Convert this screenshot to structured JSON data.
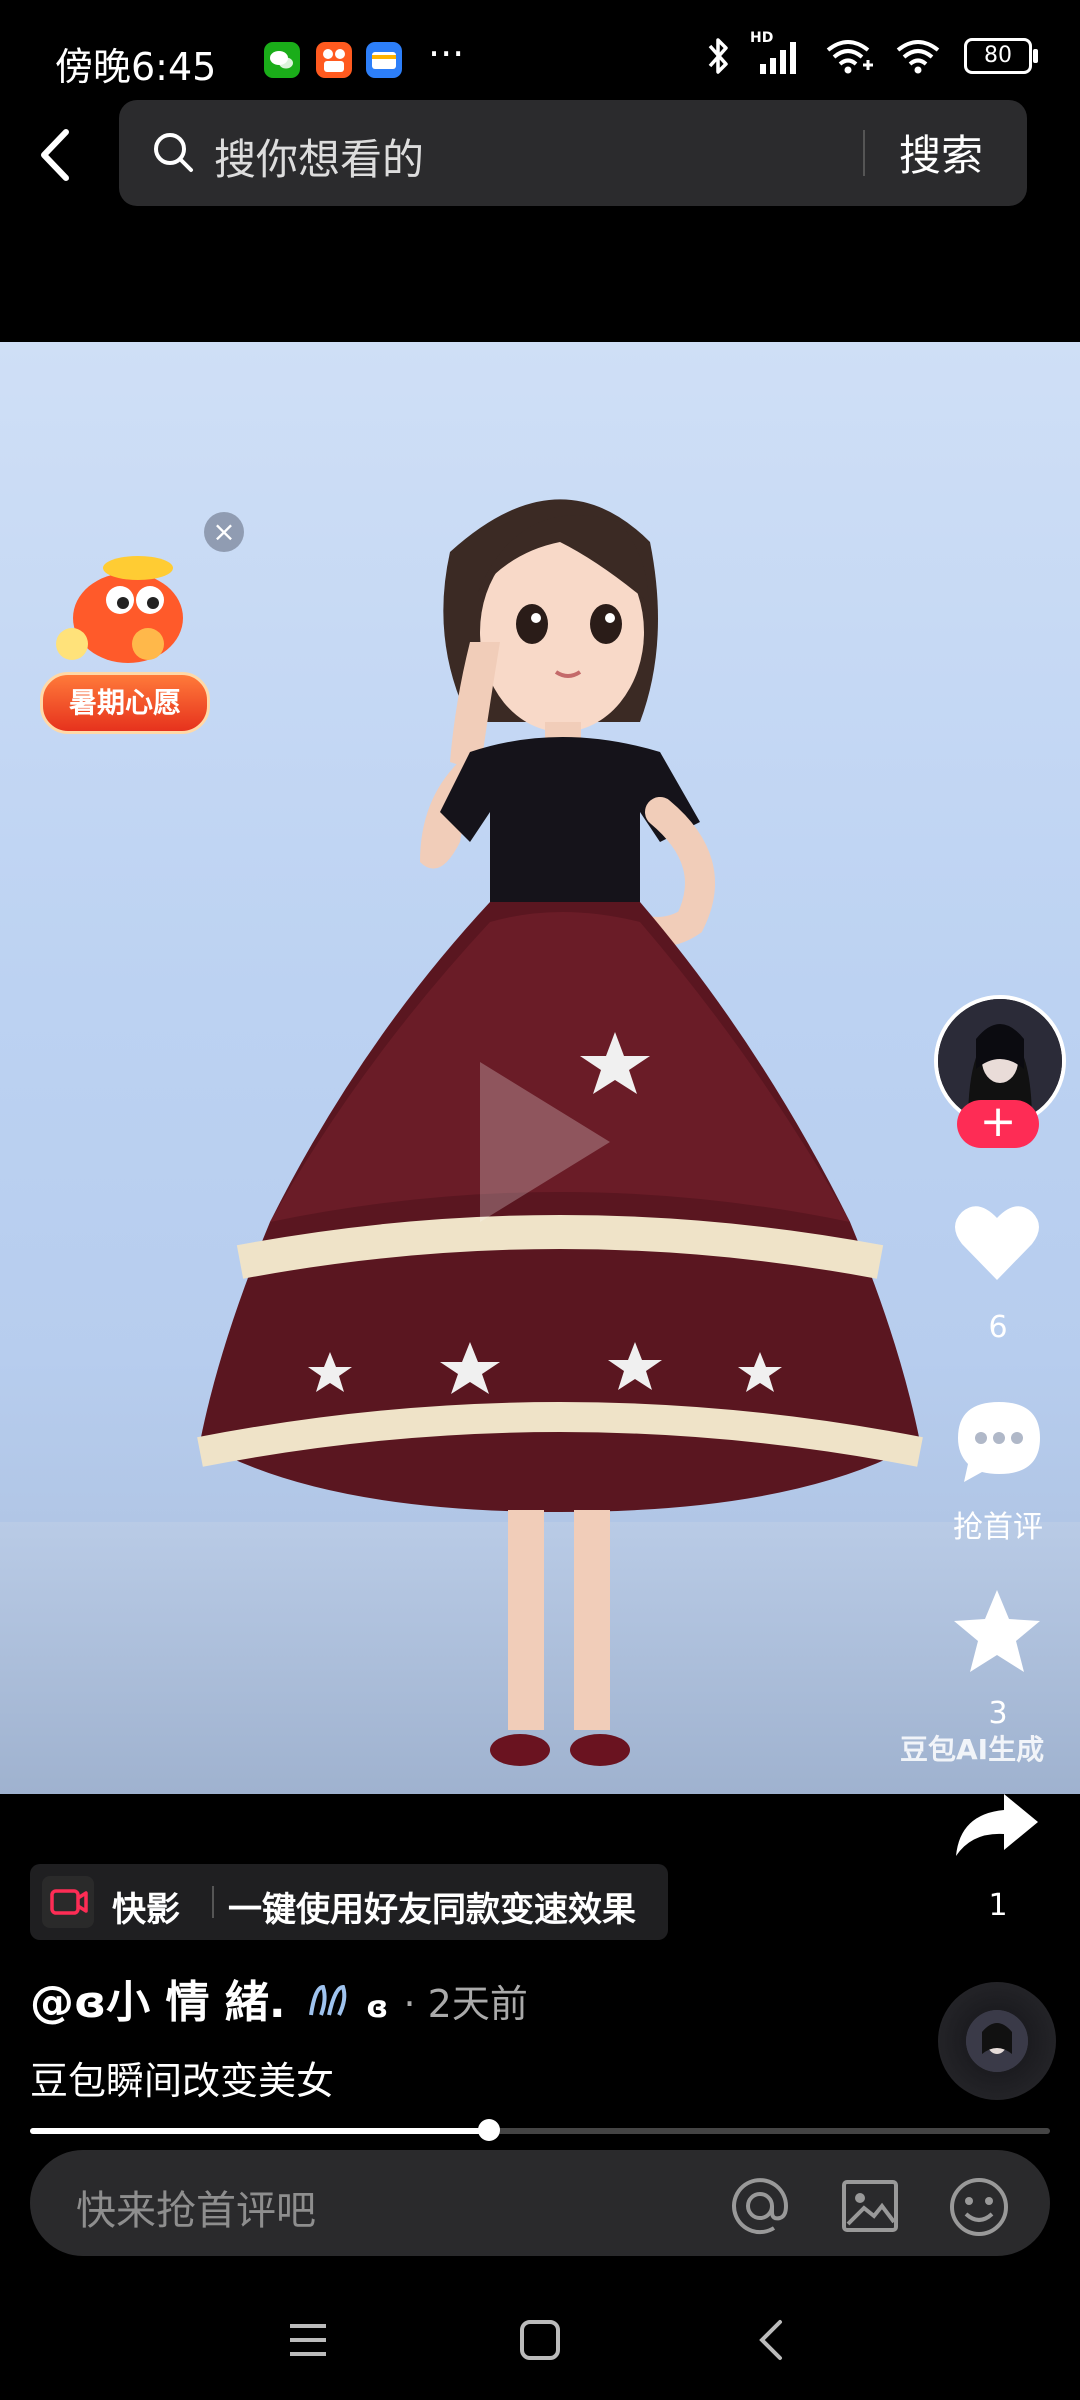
{
  "status_bar": {
    "time": "傍晚6:45",
    "battery": "80",
    "more": "···",
    "network_badge": "HD"
  },
  "header": {
    "search_placeholder": "搜你想看的",
    "search_button": "搜索"
  },
  "promo": {
    "label": "暑期心愿",
    "close": "×"
  },
  "side_actions": {
    "follow": "+",
    "like_count": "6",
    "comment_label": "抢首评",
    "favorite_count": "3",
    "share_count": "1"
  },
  "watermark": "豆包AI生成",
  "app_chip": {
    "name": "快影",
    "text": "一键使用好友同款变速效果"
  },
  "post": {
    "author": "@ɞ小 情 緒.",
    "author_suffix": "ɞ",
    "separator": "·",
    "time": "2天前",
    "caption": "豆包瞬间改变美女"
  },
  "progress": {
    "fraction": 0.45
  },
  "comment_bar": {
    "placeholder": "快来抢首评吧"
  },
  "colors": {
    "follow": "#fe2c55",
    "background": "#000000",
    "dress": "#5a1620"
  }
}
